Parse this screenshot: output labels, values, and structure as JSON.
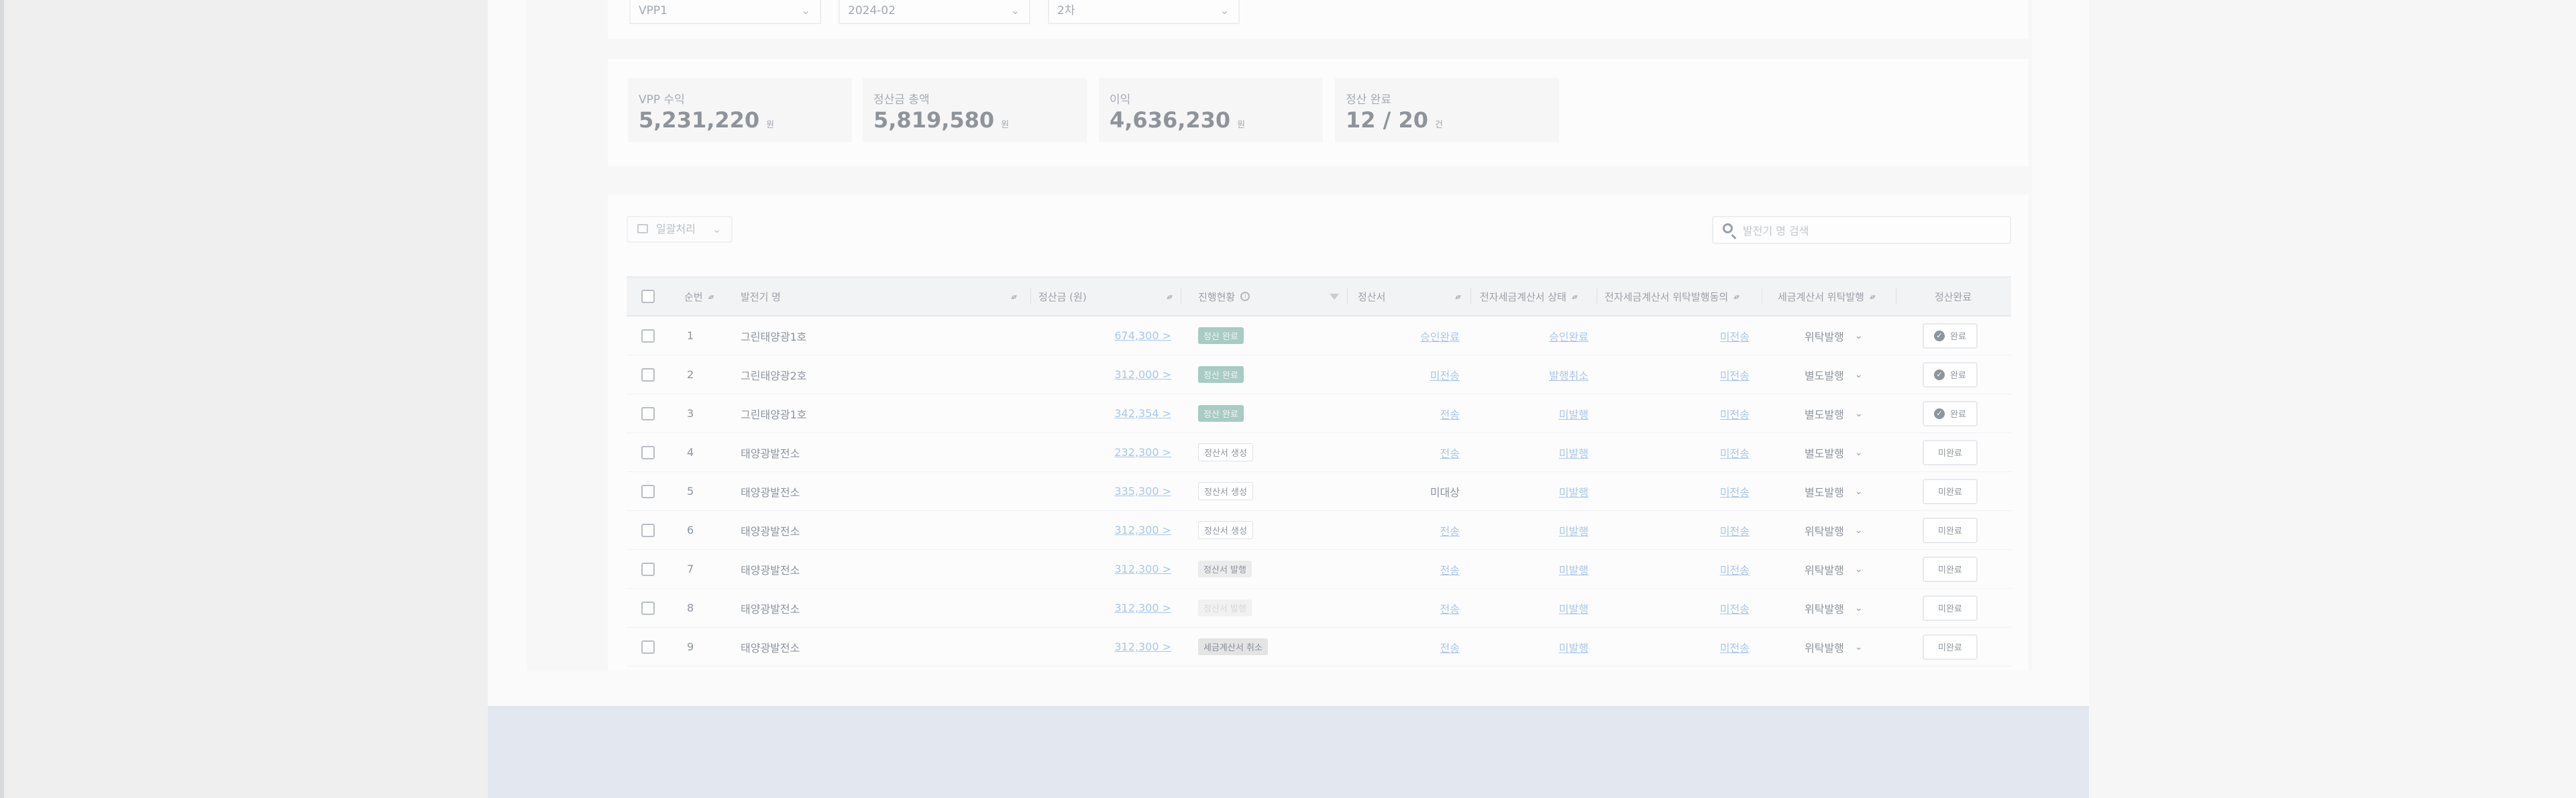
{
  "filters": [
    {
      "value": "VPP1"
    },
    {
      "value": "2024-02"
    },
    {
      "value": "2차"
    }
  ],
  "summary": [
    {
      "label": "VPP 수익",
      "value": "5,231,220",
      "unit": "원"
    },
    {
      "label": "정산금 총액",
      "value": "5,819,580",
      "unit": "원"
    },
    {
      "label": "이익",
      "value": "4,636,230",
      "unit": "원"
    },
    {
      "label": "정산 완료",
      "value": "12 / 20",
      "unit": "건"
    }
  ],
  "toolbar": {
    "bulk_label": "일괄처리",
    "search_placeholder": "발전기 명 검색"
  },
  "table": {
    "headers": {
      "no": "순번",
      "plant": "발전기 명",
      "amount": "정산금 (원)",
      "status": "진행현황",
      "statement": "정산서",
      "einvoice_status": "전자세금계산서 상태",
      "consign_agree": "전자세금계산서 위탁발행동의",
      "issue_type": "세금계산서 위탁발행",
      "settle": "정산완료"
    },
    "rows": [
      {
        "no": "1",
        "plant": "그린태양광1호",
        "amount": "674,300 >",
        "status": "정산 완료",
        "status_kind": "done",
        "statement": "승인완료",
        "statement_link": true,
        "einvoice": "승인완료",
        "agree": "미전송",
        "issue": "위탁발행",
        "settle": "완료",
        "settled": true
      },
      {
        "no": "2",
        "plant": "그린태양광2호",
        "amount": "312,000 >",
        "status": "정산 완료",
        "status_kind": "done",
        "statement": "미전송",
        "statement_link": true,
        "einvoice": "발행취소",
        "agree": "미전송",
        "issue": "별도발행",
        "settle": "완료",
        "settled": true
      },
      {
        "no": "3",
        "plant": "그린태양광1호",
        "amount": "342,354 >",
        "status": "정산 완료",
        "status_kind": "done",
        "statement": "전송",
        "statement_link": true,
        "einvoice": "미발행",
        "agree": "미전송",
        "issue": "별도발행",
        "settle": "완료",
        "settled": true
      },
      {
        "no": "4",
        "plant": "태양광발전소",
        "amount": "232,300 >",
        "status": "정산서 생성",
        "status_kind": "gen",
        "statement": "전송",
        "statement_link": true,
        "einvoice": "미발행",
        "agree": "미전송",
        "issue": "별도발행",
        "settle": "미완료",
        "settled": false
      },
      {
        "no": "5",
        "plant": "태양광발전소",
        "amount": "335,300 >",
        "status": "정산서 생성",
        "status_kind": "gen",
        "statement": "미대상",
        "statement_link": false,
        "einvoice": "미발행",
        "agree": "미전송",
        "issue": "별도발행",
        "settle": "미완료",
        "settled": false
      },
      {
        "no": "6",
        "plant": "태양광발전소",
        "amount": "312,300 >",
        "status": "정산서 생성",
        "status_kind": "gen",
        "statement": "전송",
        "statement_link": true,
        "einvoice": "미발행",
        "agree": "미전송",
        "issue": "위탁발행",
        "settle": "미완료",
        "settled": false
      },
      {
        "no": "7",
        "plant": "태양광발전소",
        "amount": "312,300 >",
        "status": "정산서 발행",
        "status_kind": "iss",
        "statement": "전송",
        "statement_link": true,
        "einvoice": "미발행",
        "agree": "미전송",
        "issue": "위탁발행",
        "settle": "미완료",
        "settled": false
      },
      {
        "no": "8",
        "plant": "태양광발전소",
        "amount": "312,300 >",
        "status": "정산서 발행",
        "status_kind": "faint",
        "statement": "전송",
        "statement_link": true,
        "einvoice": "미발행",
        "agree": "미전송",
        "issue": "위탁발행",
        "settle": "미완료",
        "settled": false
      },
      {
        "no": "9",
        "plant": "태양광발전소",
        "amount": "312,300 >",
        "status": "세금계산서 취소",
        "status_kind": "cancel",
        "statement": "전송",
        "statement_link": true,
        "einvoice": "미발행",
        "agree": "미전송",
        "issue": "위탁발행",
        "settle": "미완료",
        "settled": false
      }
    ]
  }
}
